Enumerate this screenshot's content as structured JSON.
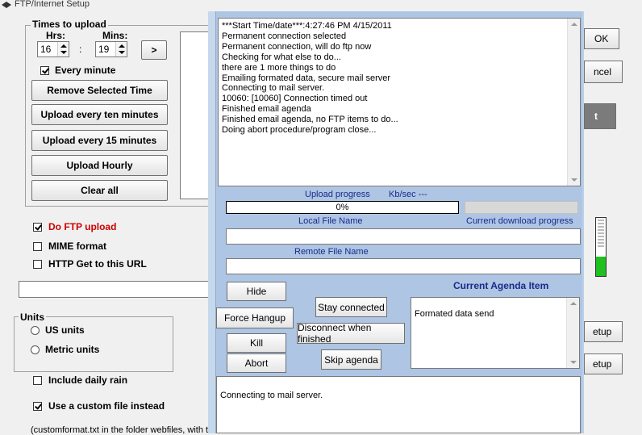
{
  "window": {
    "title": "FTP/Internet Setup"
  },
  "times_group": {
    "legend": "Times to upload",
    "hrs_label": "Hrs:",
    "mins_label": "Mins:",
    "hrs_value": "16",
    "mins_value": "19",
    "colon": ":",
    "add_label": ">",
    "every_minute_label": "Every minute",
    "buttons": {
      "remove_selected": "Remove Selected Time",
      "every_ten": "Upload every ten minutes",
      "every_15": "Upload every 15 minutes",
      "hourly": "Upload Hourly",
      "clear_all": "Clear all"
    }
  },
  "options": {
    "do_ftp": "Do FTP upload",
    "mime": "MIME format",
    "http_get": "HTTP Get to this URL"
  },
  "units_group": {
    "legend": "Units",
    "us": "US units",
    "metric": "Metric units"
  },
  "include_daily_rain": "Include daily rain",
  "custom_file": "Use a custom file instead",
  "custom_note": "(customformat.txt in the folder webfiles, with th",
  "right_buttons": {
    "ok": "OK",
    "cancel": "ncel",
    "dark": "t",
    "setup1": "etup",
    "setup2": "etup"
  },
  "dialog": {
    "log_lines": [
      "***Start Time/date***:4:27:46 PM 4/15/2011",
      "Permanent connection selected",
      "Permanent connection, will do ftp now",
      "Checking for what else to do...",
      "there are 1 more things to do",
      "Emailing formated data, secure mail server",
      "Connecting to mail server.",
      "10060: [10060] Connection timed out",
      "Finished email agenda",
      "Finished email agenda, no FTP items to do...",
      "Doing abort procedure/program close..."
    ],
    "upload_progress_label": "Upload progress",
    "kbsec_label": "Kb/sec ---",
    "progress_value": "0%",
    "progress_fraction": 0,
    "local_file_label": "Local File Name",
    "current_download_label": "Current download progress",
    "remote_file_label": "Remote File Name",
    "current_agenda_label": "Current Agenda Item",
    "agenda_item": "Formated data send",
    "buttons": {
      "hide": "Hide",
      "force_hangup": "Force Hangup",
      "kill": "Kill",
      "abort": "Abort",
      "stay_connected": "Stay connected",
      "disconnect_finished": "Disconnect when finished",
      "skip_agenda": "Skip agenda"
    },
    "status_text": "Connecting to mail server."
  }
}
